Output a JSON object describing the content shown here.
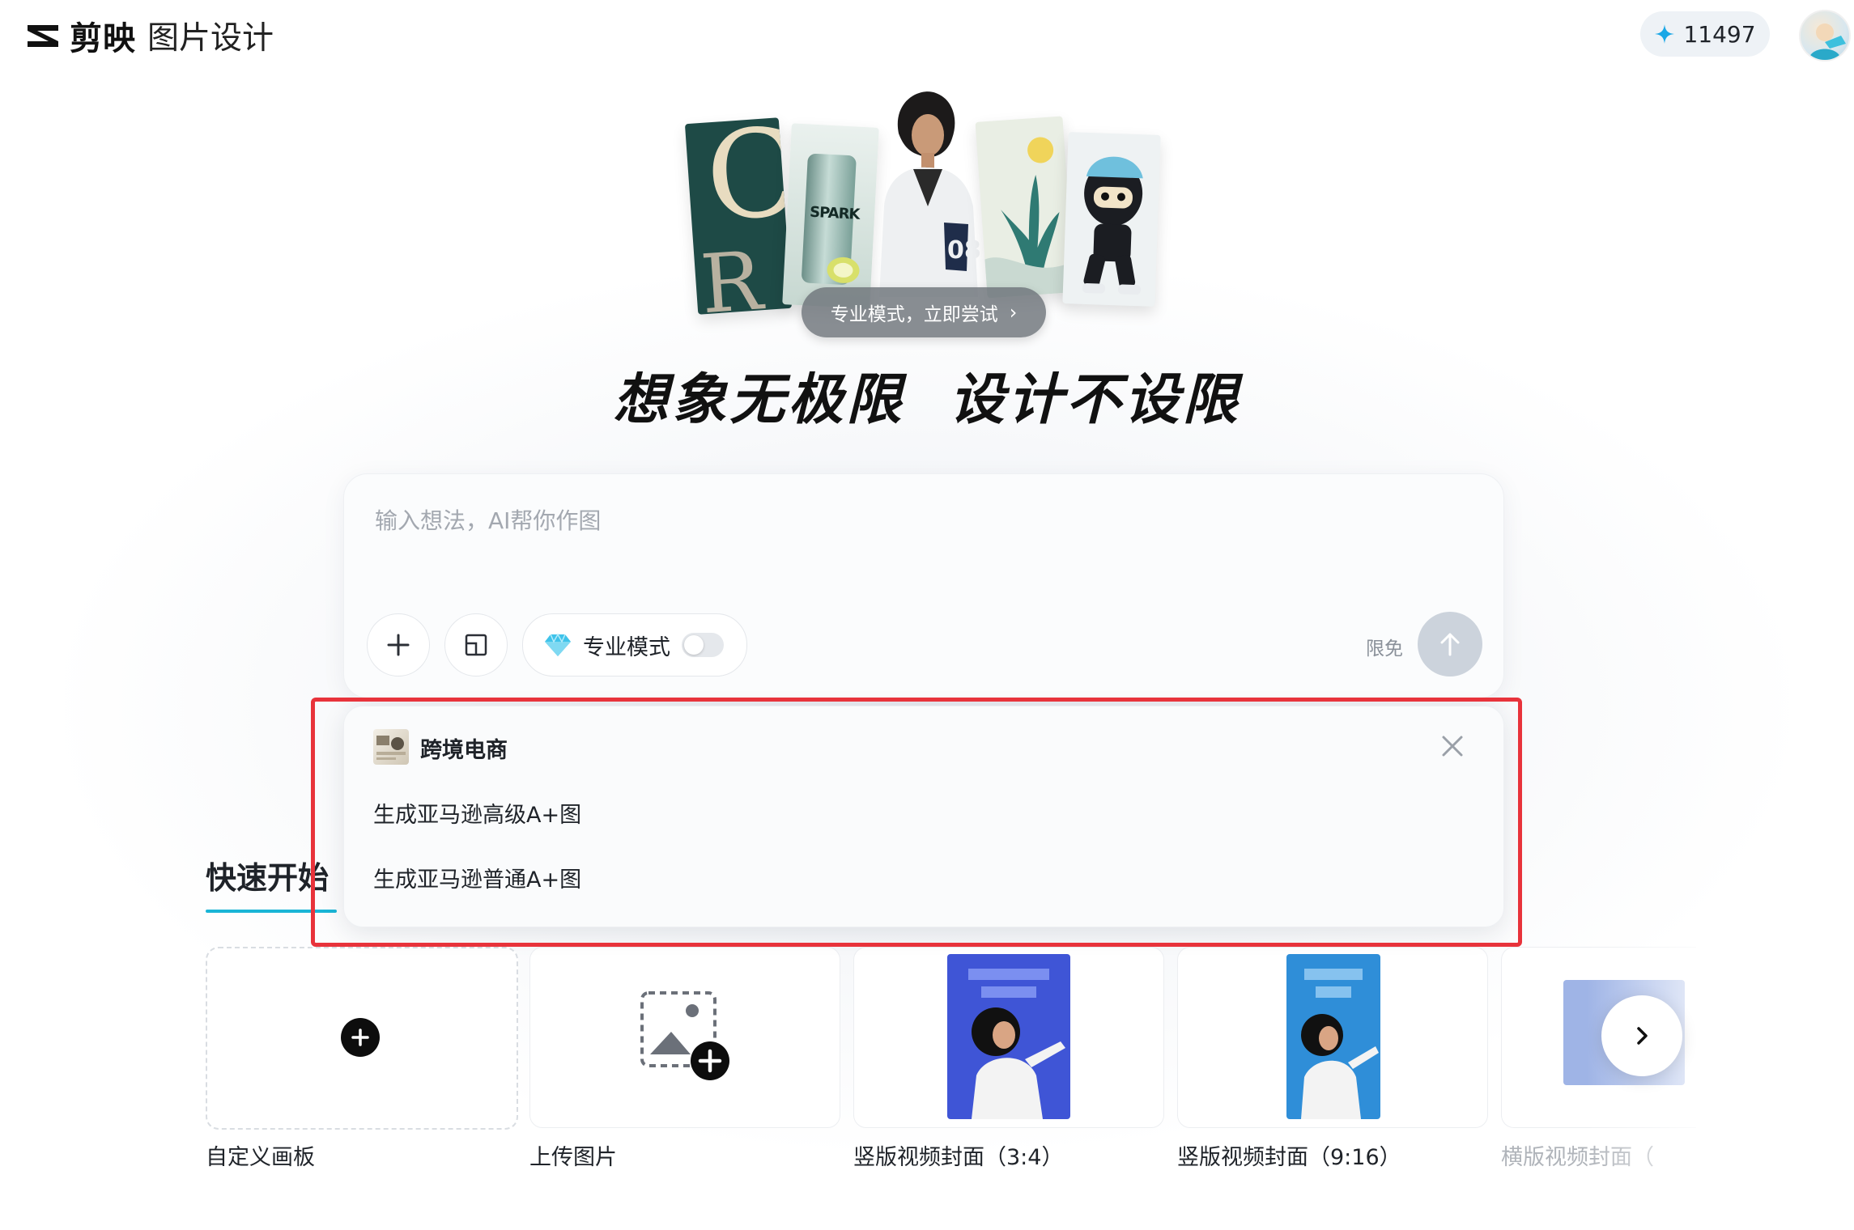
{
  "header": {
    "brand": "剪映",
    "product": "图片设计",
    "credits": "11497"
  },
  "hero": {
    "pro_pill": "专业模式，立即尝试",
    "headline": "想象无极限  设计不设限",
    "spark_text": "SPARK"
  },
  "prompt": {
    "placeholder": "输入想法，AI帮你作图",
    "value": "",
    "pro_mode_label": "专业模式",
    "pro_mode_on": false,
    "free_label": "限免"
  },
  "quick_start": {
    "title": "快速开始",
    "tiles": [
      {
        "label": "自定义画板"
      },
      {
        "label": "上传图片"
      },
      {
        "label": "竖版视频封面（3:4）"
      },
      {
        "label": "竖版视频封面（9:16）"
      },
      {
        "label": "横版视频封面（"
      }
    ]
  },
  "suggestion": {
    "category": "跨境电商",
    "items": [
      "生成亚马逊高级A+图",
      "生成亚马逊普通A+图"
    ]
  },
  "colors": {
    "accent": "#1ab5d6",
    "highlight": "#e8333b",
    "send_disabled": "#ccd3dc"
  }
}
